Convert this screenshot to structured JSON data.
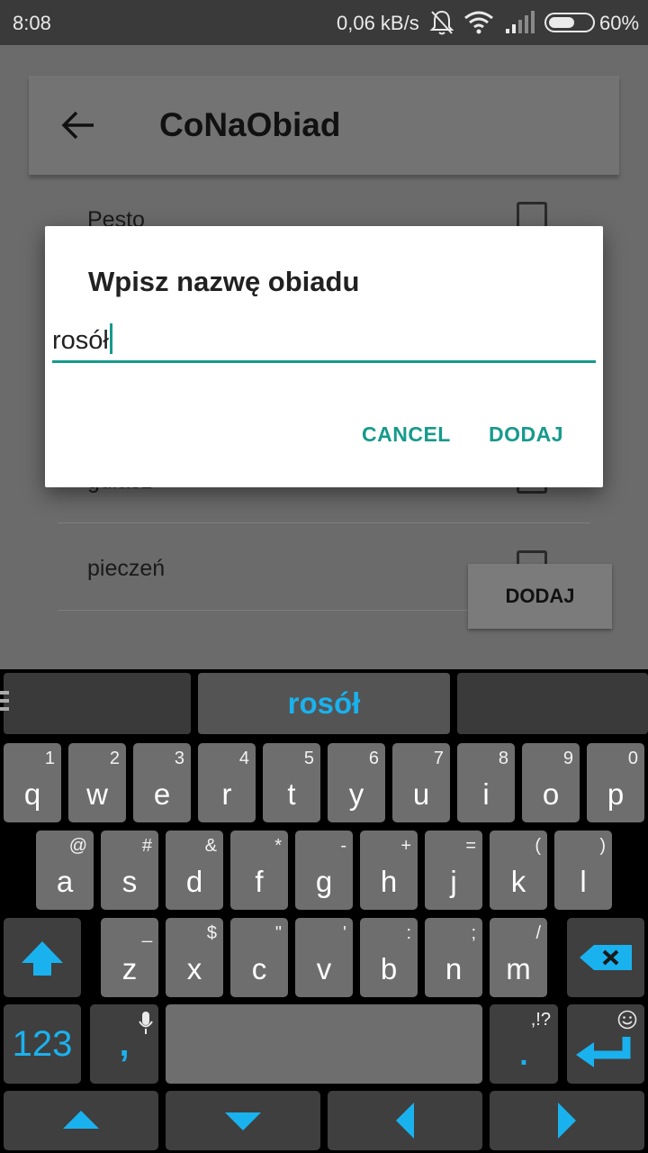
{
  "status_bar": {
    "time": "8:08",
    "network_speed": "0,06 kB/s",
    "battery_percent": "60%",
    "battery_level": 0.6,
    "icons": [
      "bell-off-icon",
      "wifi-icon",
      "signal-icon",
      "battery-icon"
    ]
  },
  "app": {
    "title": "CoNaObiad",
    "back_icon": "arrow-back-icon",
    "list_items": [
      {
        "label": "Pesto",
        "checked": false
      },
      {
        "label": "gulasz",
        "checked": false
      },
      {
        "label": "pieczeń",
        "checked": false
      }
    ],
    "add_button_label": "DODAJ"
  },
  "dialog": {
    "title": "Wpisz nazwę obiadu",
    "input_value": "rosół",
    "cancel_label": "CANCEL",
    "confirm_label": "DODAJ",
    "accent_color": "#169a8c"
  },
  "keyboard": {
    "suggestion": "rosół",
    "accent_color": "#1ab2ee",
    "row1": [
      {
        "key": "q",
        "hint": "1"
      },
      {
        "key": "w",
        "hint": "2"
      },
      {
        "key": "e",
        "hint": "3"
      },
      {
        "key": "r",
        "hint": "4"
      },
      {
        "key": "t",
        "hint": "5"
      },
      {
        "key": "y",
        "hint": "6"
      },
      {
        "key": "u",
        "hint": "7"
      },
      {
        "key": "i",
        "hint": "8"
      },
      {
        "key": "o",
        "hint": "9"
      },
      {
        "key": "p",
        "hint": "0"
      }
    ],
    "row2": [
      {
        "key": "a",
        "hint": "@"
      },
      {
        "key": "s",
        "hint": "#"
      },
      {
        "key": "d",
        "hint": "&"
      },
      {
        "key": "f",
        "hint": "*"
      },
      {
        "key": "g",
        "hint": "-"
      },
      {
        "key": "h",
        "hint": "+"
      },
      {
        "key": "j",
        "hint": "="
      },
      {
        "key": "k",
        "hint": "("
      },
      {
        "key": "l",
        "hint": ")"
      }
    ],
    "row3": [
      {
        "key": "z",
        "hint": "_"
      },
      {
        "key": "x",
        "hint": "$"
      },
      {
        "key": "c",
        "hint": "\""
      },
      {
        "key": "v",
        "hint": "'"
      },
      {
        "key": "b",
        "hint": ":"
      },
      {
        "key": "n",
        "hint": ";"
      },
      {
        "key": "m",
        "hint": "/"
      }
    ],
    "num_label": "123",
    "comma_label": ",",
    "period_label": ".",
    "period_hint": ",!?",
    "special_icons": [
      "shift-icon",
      "backspace-icon",
      "mic-icon",
      "enter-icon",
      "smiley-icon",
      "arrow-up-icon",
      "arrow-down-icon",
      "arrow-left-icon",
      "arrow-right-icon",
      "menu-icon"
    ]
  }
}
